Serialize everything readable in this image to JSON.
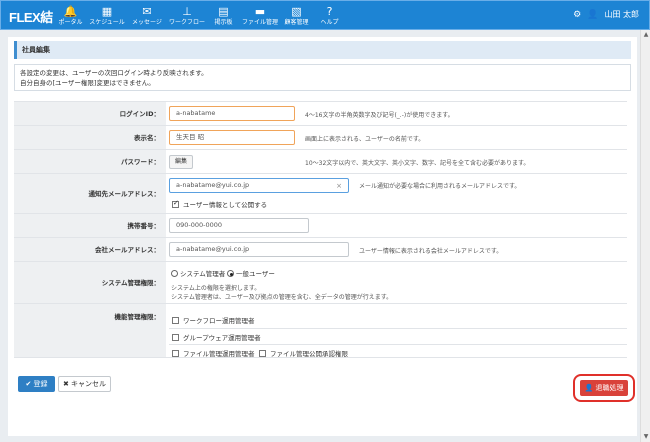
{
  "app": {
    "logo": "FLEX結"
  },
  "nav": [
    {
      "label": "ポータル",
      "icon": "bell-icon",
      "glyph": "🔔"
    },
    {
      "label": "スケジュール",
      "icon": "calendar-icon",
      "glyph": "▦"
    },
    {
      "label": "メッセージ",
      "icon": "envelope-icon",
      "glyph": "✉"
    },
    {
      "label": "ワークフロー",
      "icon": "stamp-icon",
      "glyph": "⊥"
    },
    {
      "label": "掲示板",
      "icon": "board-icon",
      "glyph": "▤"
    },
    {
      "label": "ファイル管理",
      "icon": "folder-icon",
      "glyph": "▬"
    },
    {
      "label": "顧客管理",
      "icon": "customer-icon",
      "glyph": "▧"
    },
    {
      "label": "ヘルプ",
      "icon": "help-icon",
      "glyph": "?"
    }
  ],
  "user": {
    "name": "山田 太郎",
    "settings_icon": "gear-icon",
    "user_icon": "user-icon"
  },
  "page": {
    "title": "社員編集",
    "notice_line1": "各設定の変更は、ユーザーの次回ログイン時より反映されます。",
    "notice_line2": "自分自身の[ユーザー権限]変更はできません。"
  },
  "form": {
    "login_id": {
      "label": "ログインID：",
      "value": "a-nabatame",
      "hint": "4～16文字の半角英数字及び記号(_.-)が使用できます。"
    },
    "display_name": {
      "label": "表示名：",
      "value": "生天目 昭",
      "hint": "画面上に表示される、ユーザーの名前です。"
    },
    "password": {
      "label": "パスワード：",
      "button": "編集",
      "hint": "10～32文字以内で、英大文字、英小文字、数字、記号を全て含む必要があります。"
    },
    "notify_email": {
      "label": "通知先メールアドレス：",
      "value": "a-nabatame@yui.co.jp",
      "clear": "×",
      "hint": "メール通知が必要な場合に利用されるメールアドレスです。",
      "public_label": "ユーザー情報として公開する",
      "public_checked": true
    },
    "mobile": {
      "label": "携帯番号：",
      "value": "090-000-0000"
    },
    "company_email": {
      "label": "会社メールアドレス：",
      "value": "a-nabatame@yui.co.jp",
      "hint": "ユーザー情報に表示される会社メールアドレスです。"
    },
    "system_role": {
      "label": "システム管理権限：",
      "option_admin": "システム管理者",
      "option_user": "一般ユーザー",
      "selected": "一般ユーザー",
      "desc1": "システム上の権限を選択します。",
      "desc2": "システム管理者は、ユーザー及び拠点の管理を含む、全データの管理が行えます。"
    },
    "function_role": {
      "label": "機能管理権限：",
      "items": [
        "ワークフロー運用管理者",
        "グループウェア運用管理者",
        "ファイル管理運用管理者",
        "ファイル管理公開承認権限"
      ]
    }
  },
  "footer": {
    "register": "登録",
    "cancel": "キャンセル",
    "retire": "退職処理"
  },
  "colors": {
    "topbar": "#1d84d4",
    "primary": "#2e7fc4",
    "danger": "#d9423a",
    "highlight": "#e0302a"
  }
}
